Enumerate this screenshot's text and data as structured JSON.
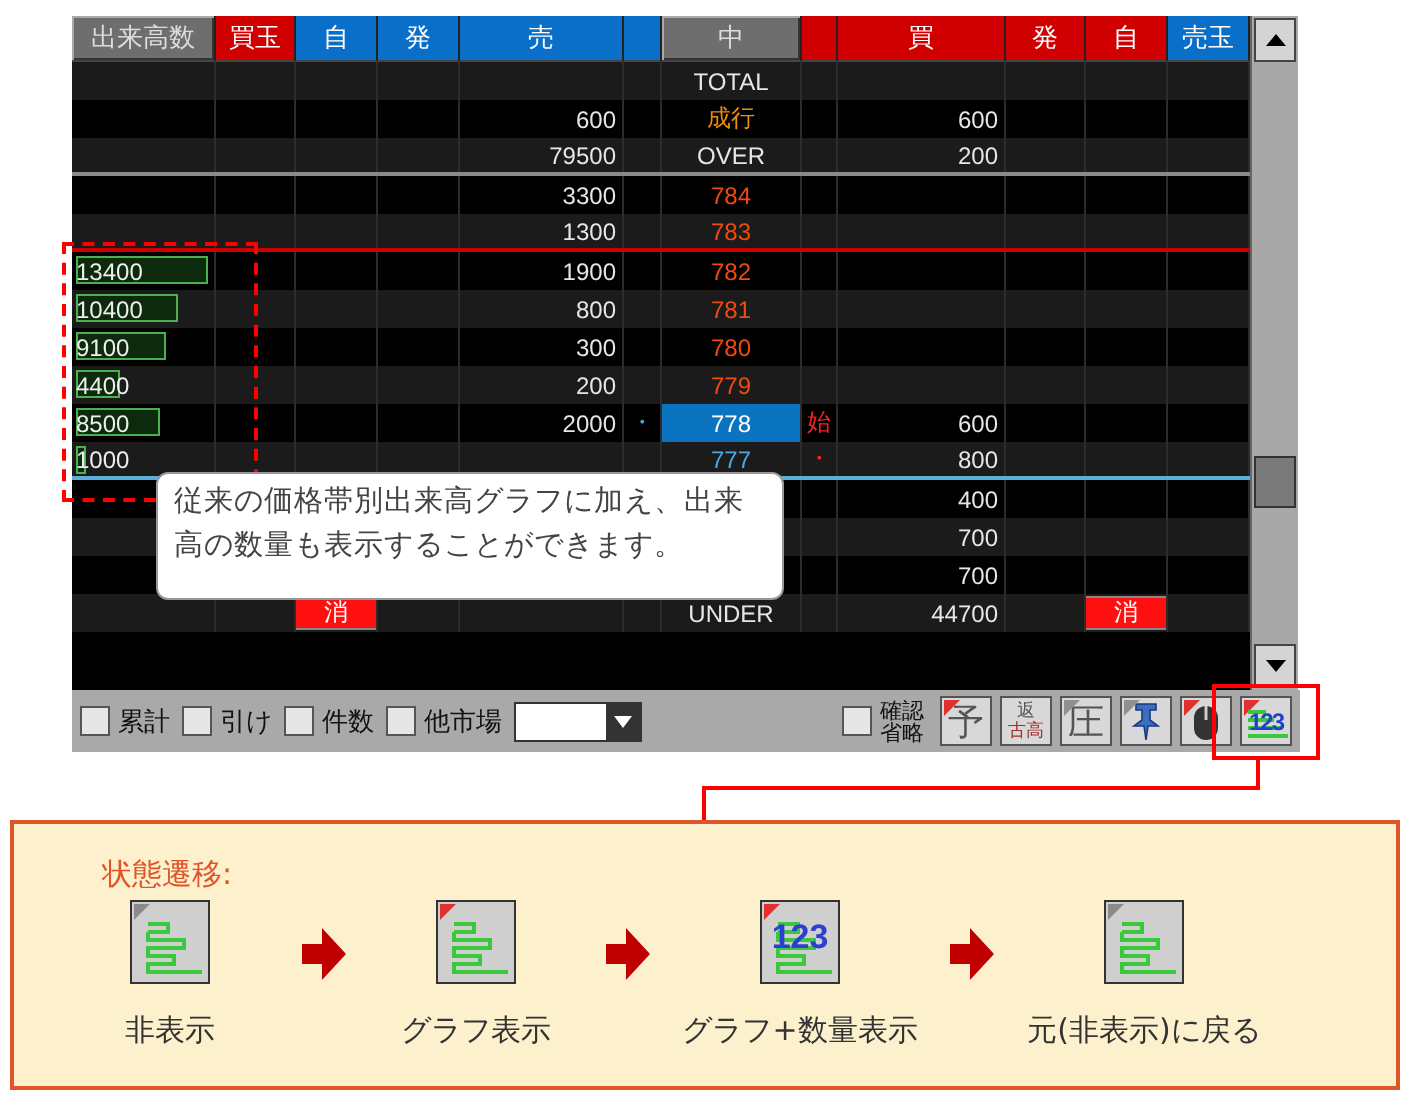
{
  "columns": [
    {
      "label": "出来高数",
      "color": "#6e6e6e"
    },
    {
      "label": "買玉",
      "color": "#d00000"
    },
    {
      "label": "自",
      "color": "#0a6fc8"
    },
    {
      "label": "発",
      "color": "#0a6fc8"
    },
    {
      "label": "売",
      "color": "#0a6fc8"
    },
    {
      "color": "#0a6fc8"
    },
    {
      "label": "中",
      "color": "#6e6e6e"
    },
    {
      "color": "#d00000"
    },
    {
      "label": "買",
      "color": "#d00000"
    },
    {
      "label": "発",
      "color": "#d00000"
    },
    {
      "label": "自",
      "color": "#d00000"
    },
    {
      "label": "売玉",
      "color": "#0a6fc8"
    }
  ],
  "rows": [
    {
      "price": {
        "text": "TOTAL",
        "color": "#e6e6e6"
      }
    },
    {
      "sell": "600",
      "price": {
        "text": "成行",
        "color": "#f08c00"
      },
      "buy": "600"
    },
    {
      "sell": "79500",
      "price": {
        "text": "OVER",
        "color": "#e6e6e6"
      },
      "buy": "200",
      "divider": {
        "color": "#8a8a8a"
      }
    },
    {
      "sell": "3300",
      "price": {
        "text": "784",
        "color": "#f04a10"
      }
    },
    {
      "sell": "1300",
      "price": {
        "text": "783",
        "color": "#f04a10"
      },
      "divider": {
        "color": "#cc0000"
      }
    },
    {
      "volume": "13400",
      "level": 1,
      "sell": "1900",
      "price": {
        "text": "782",
        "color": "#f04a10"
      }
    },
    {
      "volume": "10400",
      "level": 0.78,
      "sell": "800",
      "price": {
        "text": "781",
        "color": "#f04a10"
      }
    },
    {
      "volume": "9100",
      "level": 0.68,
      "sell": "300",
      "price": {
        "text": "780",
        "color": "#f04a10"
      }
    },
    {
      "volume": "4400",
      "level": 0.33,
      "sell": "200",
      "price": {
        "text": "779",
        "color": "#f04a10"
      }
    },
    {
      "volume": "8500",
      "level": 0.63,
      "sell": "2000",
      "sell_mark": "・",
      "price": {
        "text": "778",
        "color": "#ffffff"
      },
      "current": true,
      "buy_mark": "始",
      "buy": "600"
    },
    {
      "volume": "1000",
      "level": 0.07,
      "price": {
        "text": "777",
        "color": "#4aa8e0"
      },
      "buy_mark": "・",
      "buy": "800",
      "divider": {
        "color": "#5ab0d8"
      }
    },
    {
      "buy": "400"
    },
    {
      "buy": "700"
    },
    {
      "buy": "700"
    },
    {
      "price": {
        "text": "UNDER",
        "color": "#e6e6e6"
      },
      "buy": "44700",
      "sell_cancel": "消",
      "buy_cancel": "消"
    }
  ],
  "callout": {
    "text": "従来の価格帯別出来高グラフに加え、出来高の数量も表示することができます。"
  },
  "options": [
    {
      "label": "累計",
      "checked": false
    },
    {
      "label": "引け",
      "checked": false
    },
    {
      "label": "件数",
      "checked": false
    },
    {
      "label": "他市場",
      "checked": false
    }
  ],
  "confirm_skip": {
    "label": "確認省略",
    "checked": false
  },
  "tool_buttons": [
    {
      "kind": "text",
      "label": "予",
      "color": "#e03030"
    },
    {
      "kind": "stacked",
      "top": "返",
      "bottom": "古高"
    },
    {
      "kind": "text",
      "label": "圧",
      "color": "#909090"
    },
    {
      "kind": "pin",
      "color": "#909090"
    },
    {
      "kind": "mouse",
      "color": "#e03030"
    },
    {
      "kind": "graph_number",
      "label": "123",
      "color": "#e03030",
      "highlighted": true
    }
  ],
  "transition": {
    "title": "状態遷移:",
    "states": [
      {
        "kind": "hidden",
        "caption": "非表示"
      },
      {
        "kind": "graph",
        "caption": "グラフ表示"
      },
      {
        "kind": "graph_number",
        "label": "123",
        "caption": "グラフ+数量表示"
      },
      {
        "kind": "hidden",
        "caption": "元(非表示)に戻る"
      }
    ]
  }
}
